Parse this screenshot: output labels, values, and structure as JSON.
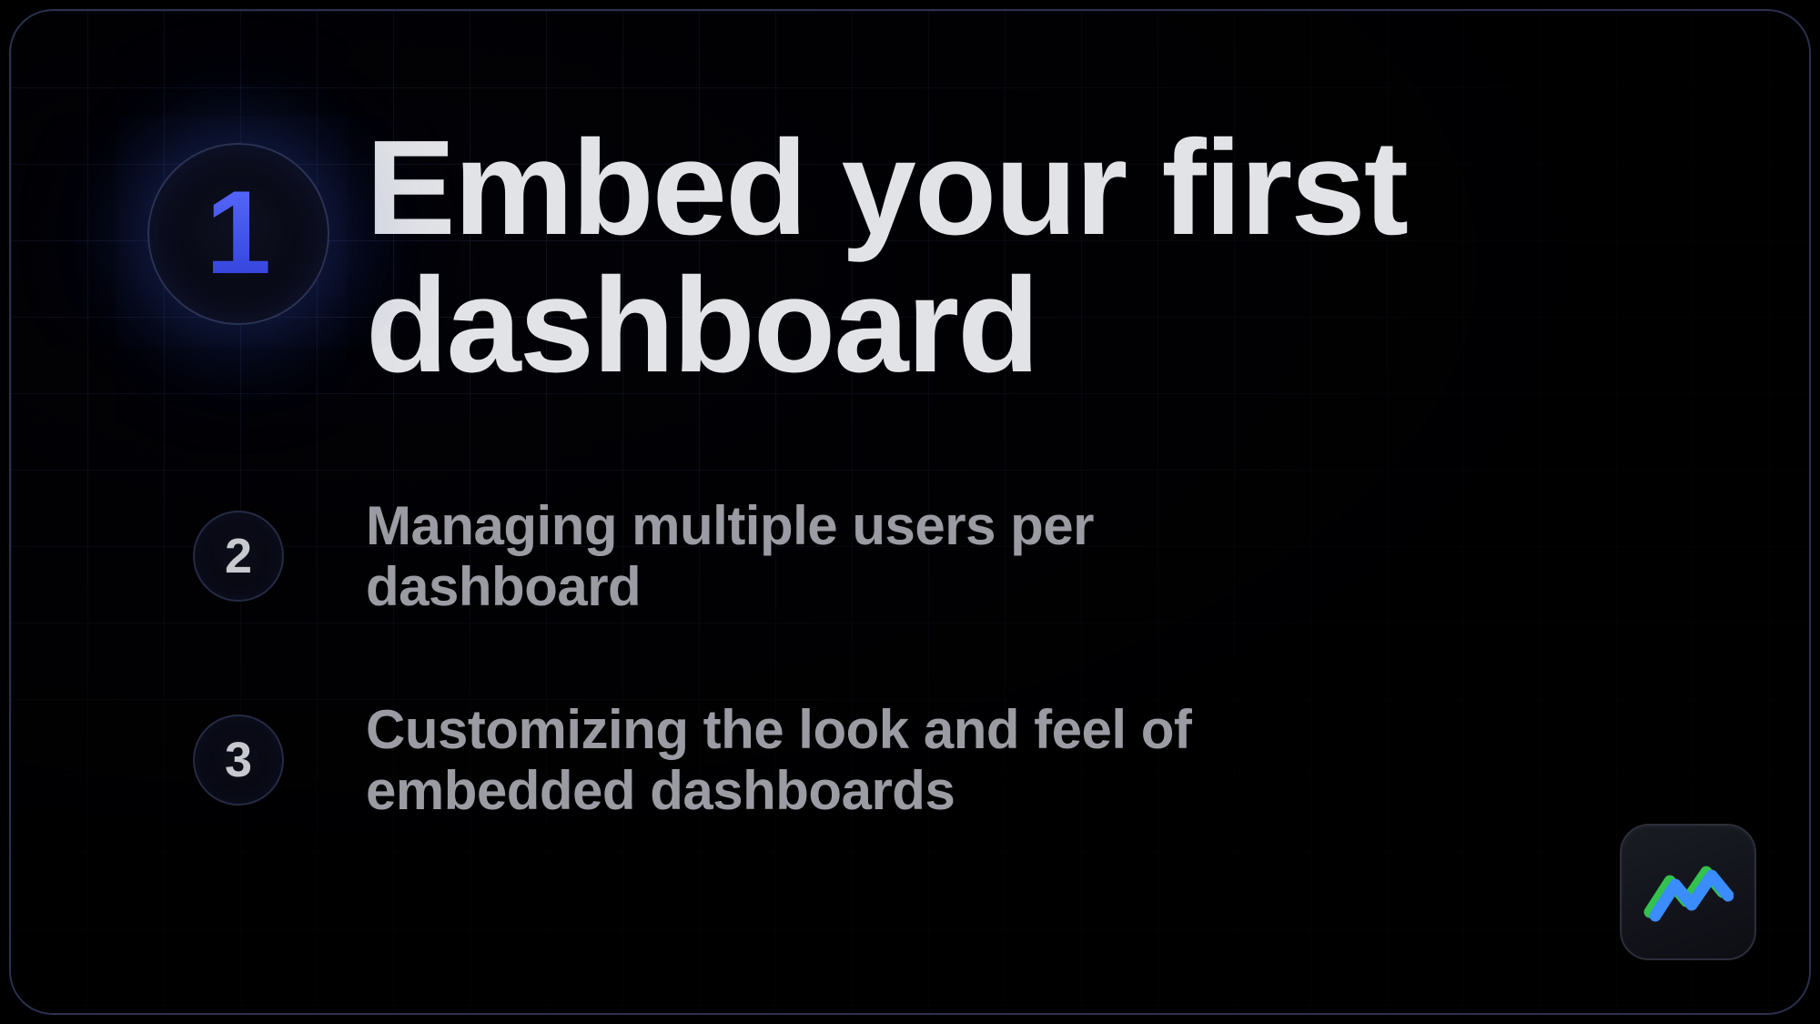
{
  "colors": {
    "accent_blue": "#4455ee",
    "text_primary": "#e2e3e6",
    "text_secondary": "#9b9ca3",
    "border": "#2a3150",
    "logo_green": "#32c24d",
    "logo_blue": "#3a8cff"
  },
  "steps": [
    {
      "number": "1",
      "title": "Embed your first dashboard",
      "active": true
    },
    {
      "number": "2",
      "title": "Managing multiple users per dashboard",
      "active": false
    },
    {
      "number": "3",
      "title": "Customizing the look and feel of embedded dashboards",
      "active": false
    }
  ]
}
